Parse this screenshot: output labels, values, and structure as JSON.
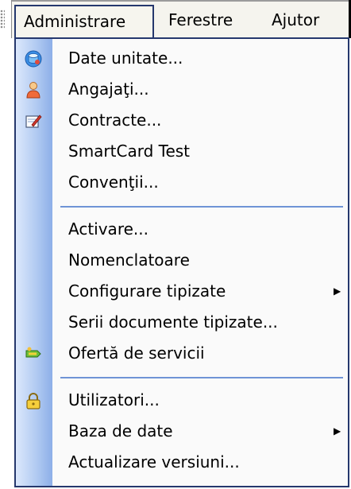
{
  "menubar": {
    "items": [
      {
        "label": "Administrare"
      },
      {
        "label": "Ferestre"
      },
      {
        "label": "Ajutor"
      }
    ]
  },
  "dropdown": {
    "items": [
      {
        "label": "Date unitate...",
        "icon": "database-icon"
      },
      {
        "label": "Angajaţi...",
        "icon": "person-icon"
      },
      {
        "label": "Contracte...",
        "icon": "contract-edit-icon"
      },
      {
        "label": "SmartCard Test"
      },
      {
        "label": "Convenţii..."
      },
      {
        "label": "Activare..."
      },
      {
        "label": "Nomenclatoare"
      },
      {
        "label": "Configurare tipizate",
        "submenu": true
      },
      {
        "label": "Serii documente tipizate..."
      },
      {
        "label": "Ofertă de servicii",
        "icon": "services-icon"
      },
      {
        "label": "Utilizatori...",
        "icon": "lock-icon"
      },
      {
        "label": "Baza de date",
        "submenu": true
      },
      {
        "label": "Actualizare versiuni..."
      }
    ],
    "submenu_glyph": "▶"
  },
  "colors": {
    "menu_border": "#25386d",
    "separator": "#6f94d6",
    "gutter_light": "#dce8fc",
    "gutter_dark": "#8dafe8"
  }
}
